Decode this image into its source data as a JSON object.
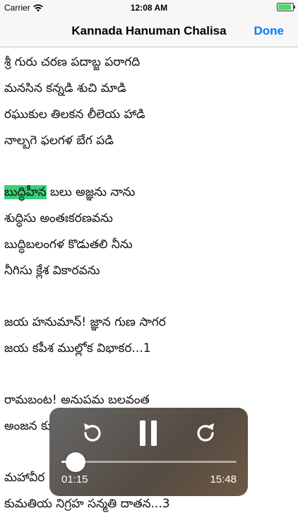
{
  "status": {
    "carrier": "Carrier",
    "time": "12:08 AM",
    "battery_level": 1.0
  },
  "nav": {
    "title": "Kannada Hanuman Chalisa",
    "done_label": "Done"
  },
  "lyrics": {
    "stanza1": [
      "శ్రీ గురు చరణ పదాబ్జ పరాగది",
      "మనసిన కన్నడి శుచి మాడి",
      "రఘుకుల తిలకన లీలెయ హాడి",
      "నాల్బగె ఫలగళ బేగ పడి"
    ],
    "stanza2_highlight": "బుద్ధిహీన",
    "stanza2_line1_rest": " బలు అజ్ఞను నాను",
    "stanza2": [
      "శుద్ధిసు అంతఃకరణవను",
      "బుద్ధిబలంగళ కొడుతలి నీను",
      "నీగిసు క్లేశ వికారవను"
    ],
    "stanza3": [
      "జయ హనుమాన్! జ్ఞాన గుణ సాగర",
      "జయ కపీశ ముల్లోక విభాకర...1"
    ],
    "stanza4": [
      "రామబంట! అనుపమ బలవంత",
      "అంజన కు"
    ],
    "stanza5": [
      "మహావీర",
      "కుమతియ నిగ్రహ సన్మతి దాతన...3"
    ]
  },
  "player": {
    "elapsed": "01:15",
    "total": "15:48",
    "progress": 0.079,
    "icons": [
      "rewind-icon",
      "pause-icon",
      "forward-icon"
    ]
  }
}
